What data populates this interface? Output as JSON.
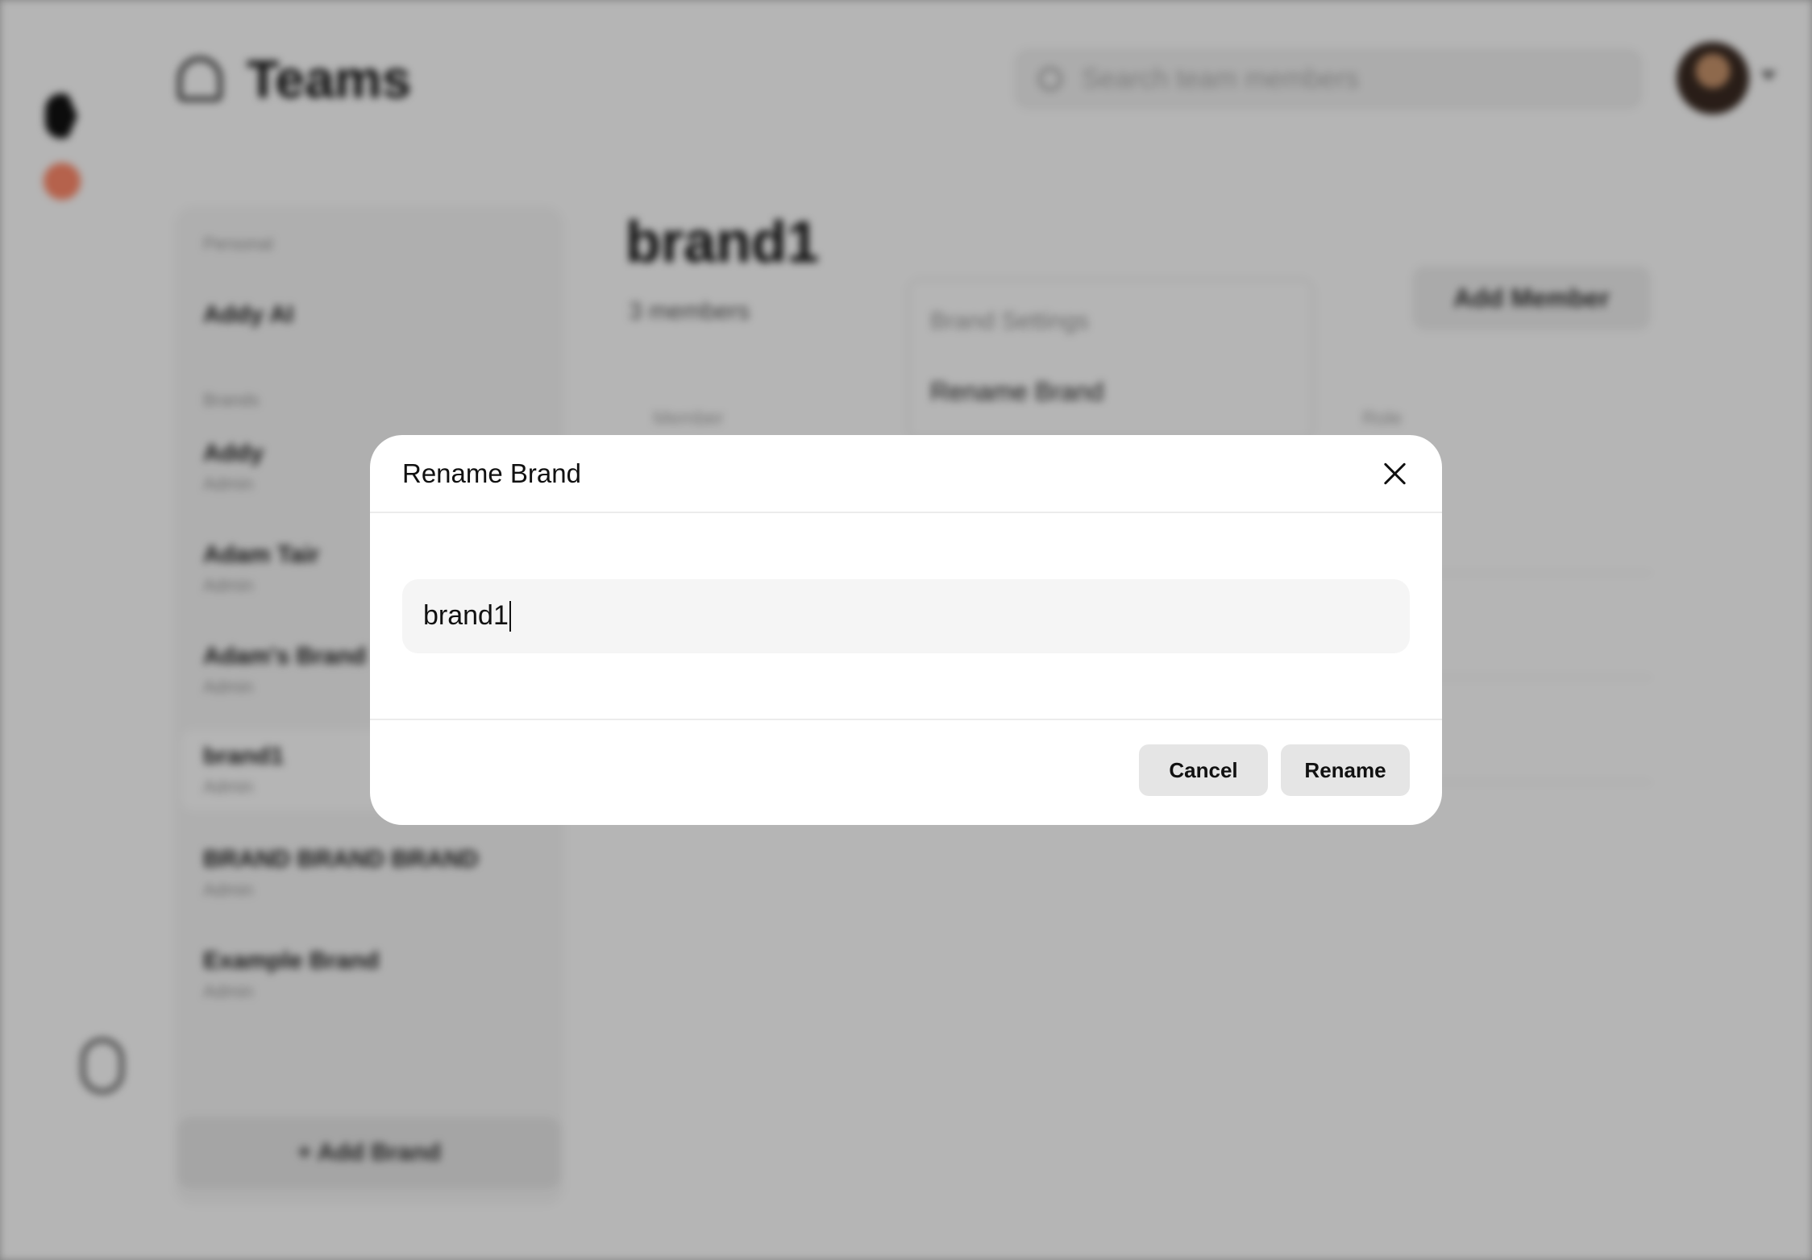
{
  "background": {
    "page_title": "Teams",
    "search_placeholder": "Search team members",
    "sidebar": {
      "section_personal": "Personal",
      "personal_item": "Addy AI",
      "section_brands": "Brands",
      "items": [
        {
          "name": "Addy",
          "role": "Admin"
        },
        {
          "name": "Adam Tair",
          "role": "Admin"
        },
        {
          "name": "Adam's Brand",
          "role": "Admin"
        },
        {
          "name": "brand1",
          "role": "Admin"
        },
        {
          "name": "BRAND BRAND BRAND",
          "role": "Admin"
        },
        {
          "name": "Example Brand",
          "role": "Admin"
        }
      ],
      "add_brand_label": "+ Add Brand"
    },
    "brand_heading": "brand1",
    "member_count": "3 members",
    "settings_menu": {
      "title": "Brand Settings",
      "rename_item": "Rename Brand"
    },
    "add_member_label": "Add Member",
    "table_headers": {
      "member": "Member",
      "role": "Role"
    }
  },
  "modal": {
    "title": "Rename Brand",
    "input_value": "brand1",
    "cancel_label": "Cancel",
    "rename_label": "Rename"
  },
  "colors": {
    "overlay": "#000000",
    "button_bg": "#e5e5e5",
    "input_bg": "#f5f5f5",
    "accent_dot": "#ff8a6b"
  }
}
